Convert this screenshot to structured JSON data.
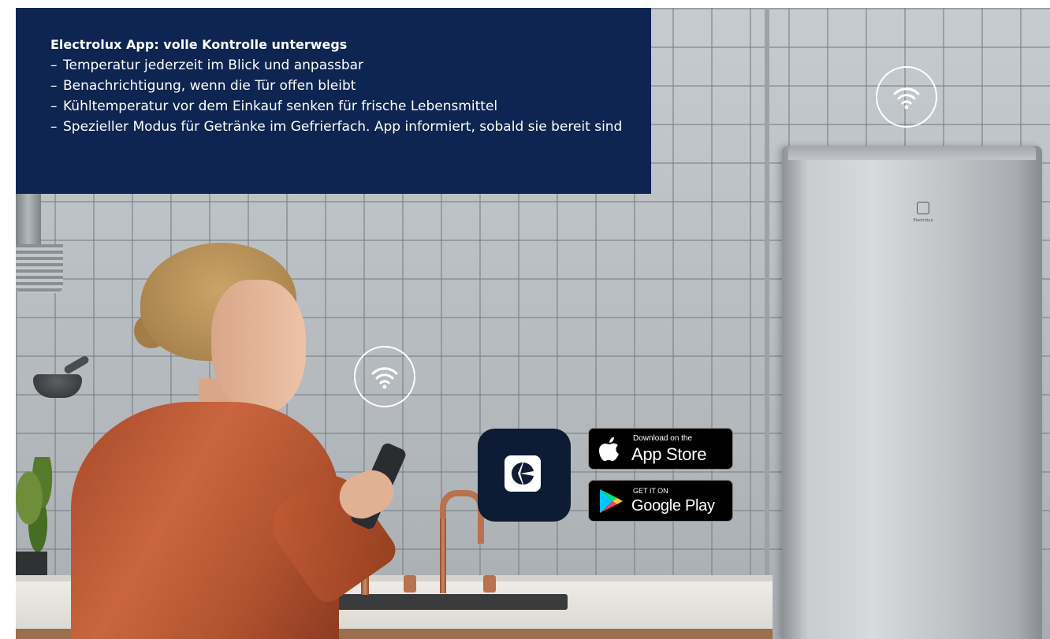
{
  "info": {
    "title": "Electrolux App: volle Kontrolle unterwegs",
    "items": [
      "Temperatur jederzeit im Blick und anpassbar",
      "Benachrichtigung, wenn die Tür offen bleibt",
      "Kühltemperatur vor dem Einkauf senken für frische Lebensmittel",
      "Spezieller Modus für Getränke im Gefrierfach. App informiert, sobald sie bereit sind"
    ]
  },
  "badges": {
    "app_store": {
      "small": "Download on the",
      "big": "App Store"
    },
    "google_play": {
      "small": "GET IT ON",
      "big": "Google Play"
    }
  },
  "fridge": {
    "brand": "Electrolux"
  },
  "icons": {
    "wifi": "wifi-icon",
    "app": "electrolux-logo-icon",
    "apple": "apple-icon",
    "google_play": "google-play-icon"
  },
  "colors": {
    "info_background": "#0d2550",
    "app_icon_background": "#0d1b34",
    "badge_background": "#000000"
  }
}
